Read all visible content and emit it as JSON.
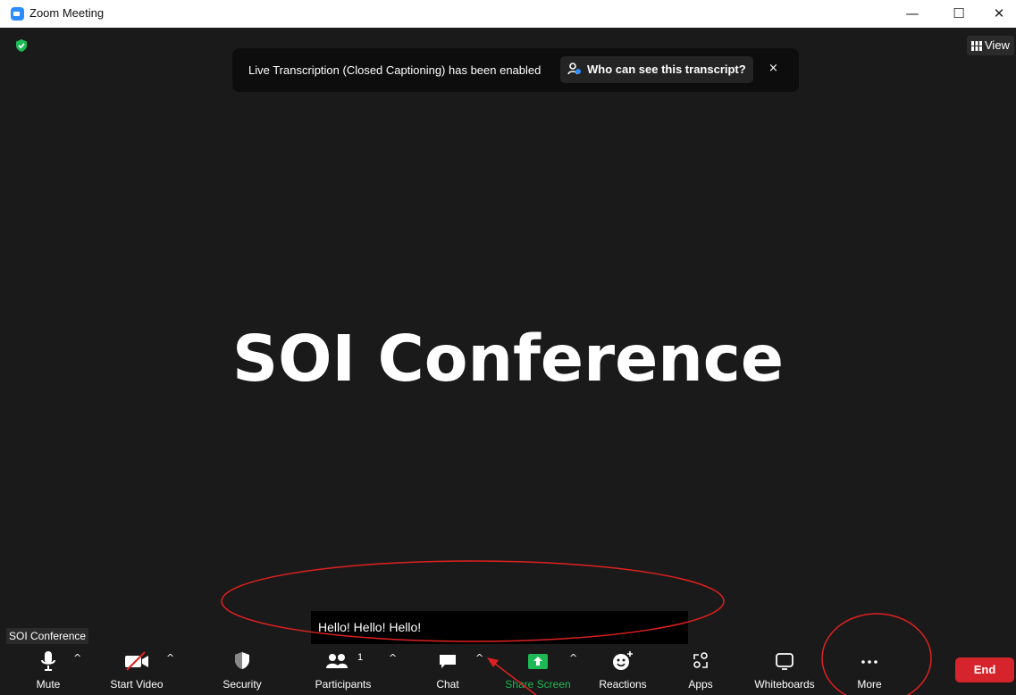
{
  "window": {
    "title": "Zoom Meeting",
    "minimize": "—",
    "maximize": "☐",
    "close": "✕"
  },
  "view_button": {
    "label": "View"
  },
  "banner": {
    "message": "Live Transcription (Closed Captioning) has been enabled",
    "who_label": "Who can see this transcript?",
    "close": "×"
  },
  "shared_content": {
    "text": "SOI Conference"
  },
  "caption": {
    "text": "Hello! Hello! Hello!"
  },
  "participant_name": "SOI Conference",
  "toolbar": {
    "mute": "Mute",
    "start_video": "Start Video",
    "security": "Security",
    "participants": "Participants",
    "participants_count": "1",
    "chat": "Chat",
    "share_screen": "Share Screen",
    "reactions": "Reactions",
    "apps": "Apps",
    "whiteboards": "Whiteboards",
    "more": "More",
    "end": "End",
    "caret": "^"
  },
  "colors": {
    "accent_green": "#1db954",
    "end_red": "#d5242b",
    "annotation_red": "#e02020",
    "brand_blue": "#2d8cff"
  }
}
